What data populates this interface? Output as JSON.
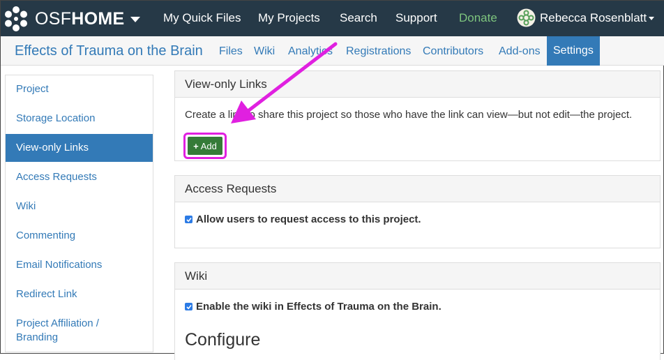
{
  "brand": {
    "prefix": "OSF",
    "suffix": "HOME",
    "icon": "osf-logo-icon"
  },
  "topnav": {
    "links": [
      "My Quick Files",
      "My Projects",
      "Search",
      "Support",
      "Donate"
    ],
    "user_name": "Rebecca Rosenblatt"
  },
  "project": {
    "title": "Effects of Trauma on the Brain",
    "tabs": [
      "Files",
      "Wiki",
      "Analytics",
      "Registrations",
      "Contributors",
      "Add-ons",
      "Settings"
    ],
    "active_tab": "Settings"
  },
  "sidebar": {
    "items": [
      {
        "label": "Project"
      },
      {
        "label": "Storage Location"
      },
      {
        "label": "View-only Links"
      },
      {
        "label": "Access Requests"
      },
      {
        "label": "Wiki"
      },
      {
        "label": "Commenting"
      },
      {
        "label": "Email Notifications"
      },
      {
        "label": "Redirect Link"
      },
      {
        "label": "Project Affiliation /",
        "line2": "Branding"
      }
    ],
    "active": "View-only Links"
  },
  "panels": {
    "view_only": {
      "title": "View-only Links",
      "description": "Create a link to share this project so those who have the link can view—but not edit—the project.",
      "add_label": "Add",
      "add_icon": "plus-icon"
    },
    "access_requests": {
      "title": "Access Requests",
      "checkbox_label": "Allow users to request access to this project.",
      "checked": true
    },
    "wiki": {
      "title": "Wiki",
      "checkbox_label": "Enable the wiki in Effects of Trauma on the Brain.",
      "checked": true,
      "configure_heading": "Configure"
    }
  },
  "annotation": {
    "arrow_color": "#e020e0"
  },
  "colors": {
    "topnav_bg": "#263947",
    "link": "#337ab7",
    "active_bg": "#337ab7",
    "donate": "#7ec57e",
    "add_button": "#357b38",
    "highlight": "#e020e0"
  }
}
